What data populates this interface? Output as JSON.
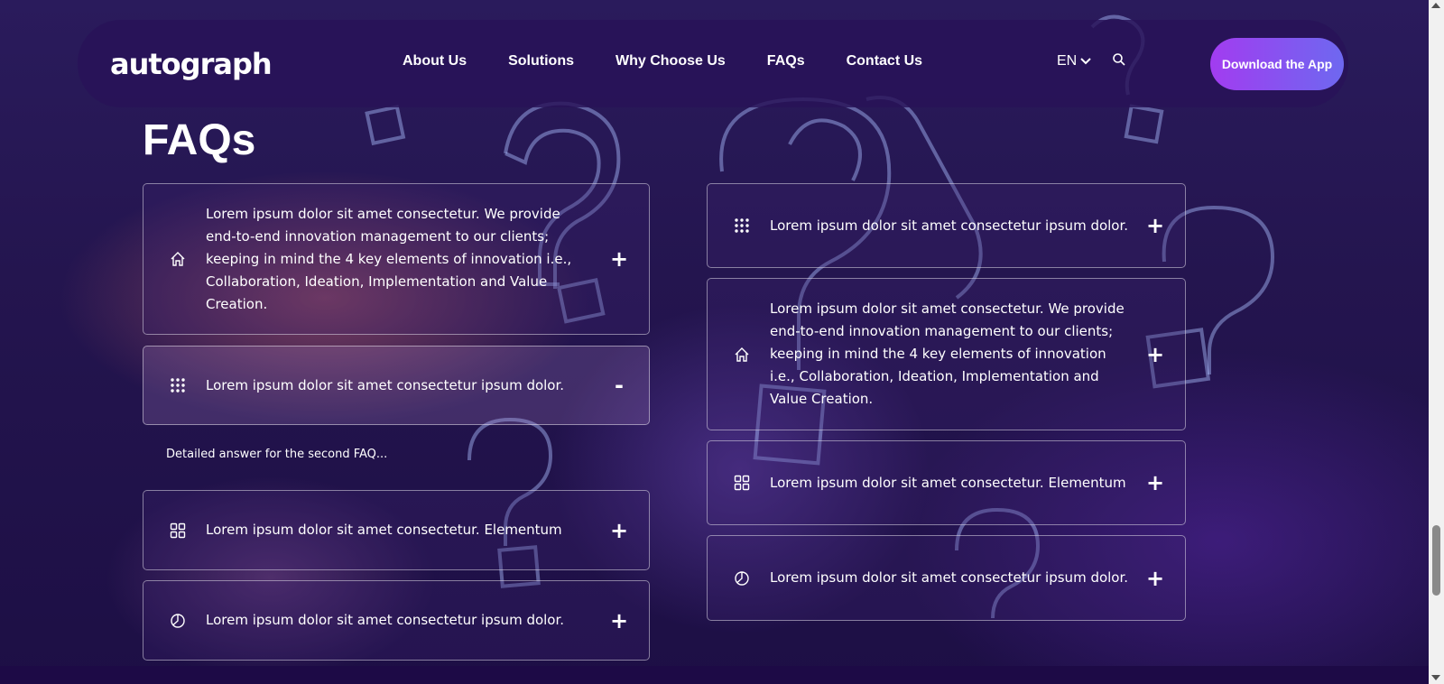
{
  "brand": {
    "logo_text": "autograph"
  },
  "nav": {
    "links": [
      "About Us",
      "Solutions",
      "Why Choose Us",
      "FAQs",
      "Contact Us"
    ],
    "language": "EN",
    "download_label": "Download the App"
  },
  "faq": {
    "heading": "FAQs",
    "left": [
      {
        "icon": "home-icon",
        "question": "Lorem ipsum dolor sit amet consectetur. We provide end-to-end innovation management to our clients; keeping in mind the 4 key elements of innovation i.e., Collaboration, Ideation, Implementation and Value Creation.",
        "toggle": "+"
      },
      {
        "icon": "dots-grid-icon",
        "question": "Lorem ipsum dolor sit amet consectetur ipsum dolor.",
        "toggle": "-",
        "answer": "Detailed answer for the second FAQ..."
      },
      {
        "icon": "squares-grid-icon",
        "question": "Lorem ipsum dolor sit amet consectetur. Elementum",
        "toggle": "+"
      },
      {
        "icon": "pie-chart-icon",
        "question": "Lorem ipsum dolor sit amet consectetur ipsum dolor.",
        "toggle": "+"
      }
    ],
    "right": [
      {
        "icon": "dots-grid-icon",
        "question": "Lorem ipsum dolor sit amet consectetur ipsum dolor.",
        "toggle": "+"
      },
      {
        "icon": "home-icon",
        "question": "Lorem ipsum dolor sit amet consectetur. We provide end-to-end innovation management to our clients; keeping in mind the 4 key elements of innovation i.e., Collaboration, Ideation, Implementation and Value Creation.",
        "toggle": "+"
      },
      {
        "icon": "squares-grid-icon",
        "question": "Lorem ipsum dolor sit amet consectetur. Elementum",
        "toggle": "+"
      },
      {
        "icon": "pie-chart-icon",
        "question": "Lorem ipsum dolor sit amet consectetur ipsum dolor.",
        "toggle": "+"
      }
    ]
  },
  "colors": {
    "background": "#24154f",
    "navbar": "#281258",
    "button_gradient_start": "#a23cf0",
    "button_gradient_end": "#6e68f0"
  }
}
